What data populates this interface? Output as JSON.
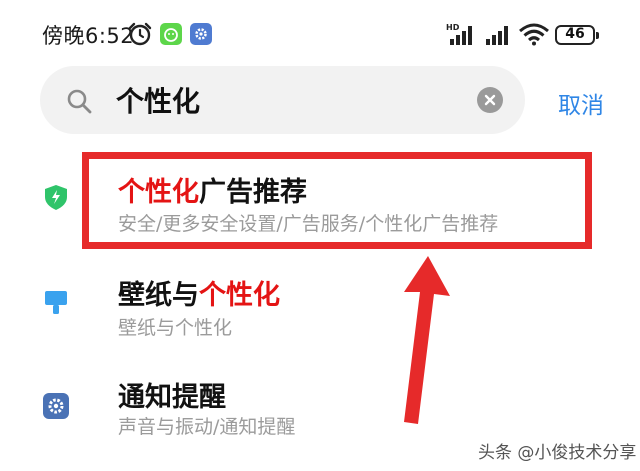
{
  "status_bar": {
    "time": "傍晚6:52",
    "battery": "46"
  },
  "search": {
    "query": "个性化",
    "cancel_label": "取消"
  },
  "results": [
    {
      "title_highlight": "个性化",
      "title_rest": "广告推荐",
      "subtitle": "安全/更多安全设置/广告服务/个性化广告推荐",
      "icon": "shield-icon"
    },
    {
      "title_plain": "壁纸与",
      "title_highlight": "个性化",
      "subtitle": "壁纸与个性化",
      "icon": "paint-brush-icon"
    },
    {
      "title_plain": "通知提醒",
      "subtitle": "声音与振动/通知提醒",
      "icon": "gear-icon"
    }
  ],
  "watermark": "头条 @小俊技术分享",
  "colors": {
    "accent_blue": "#2f86e6",
    "highlight_red": "#e41414",
    "annotation_red": "#e62a2a",
    "shield_green": "#2fc46a"
  }
}
